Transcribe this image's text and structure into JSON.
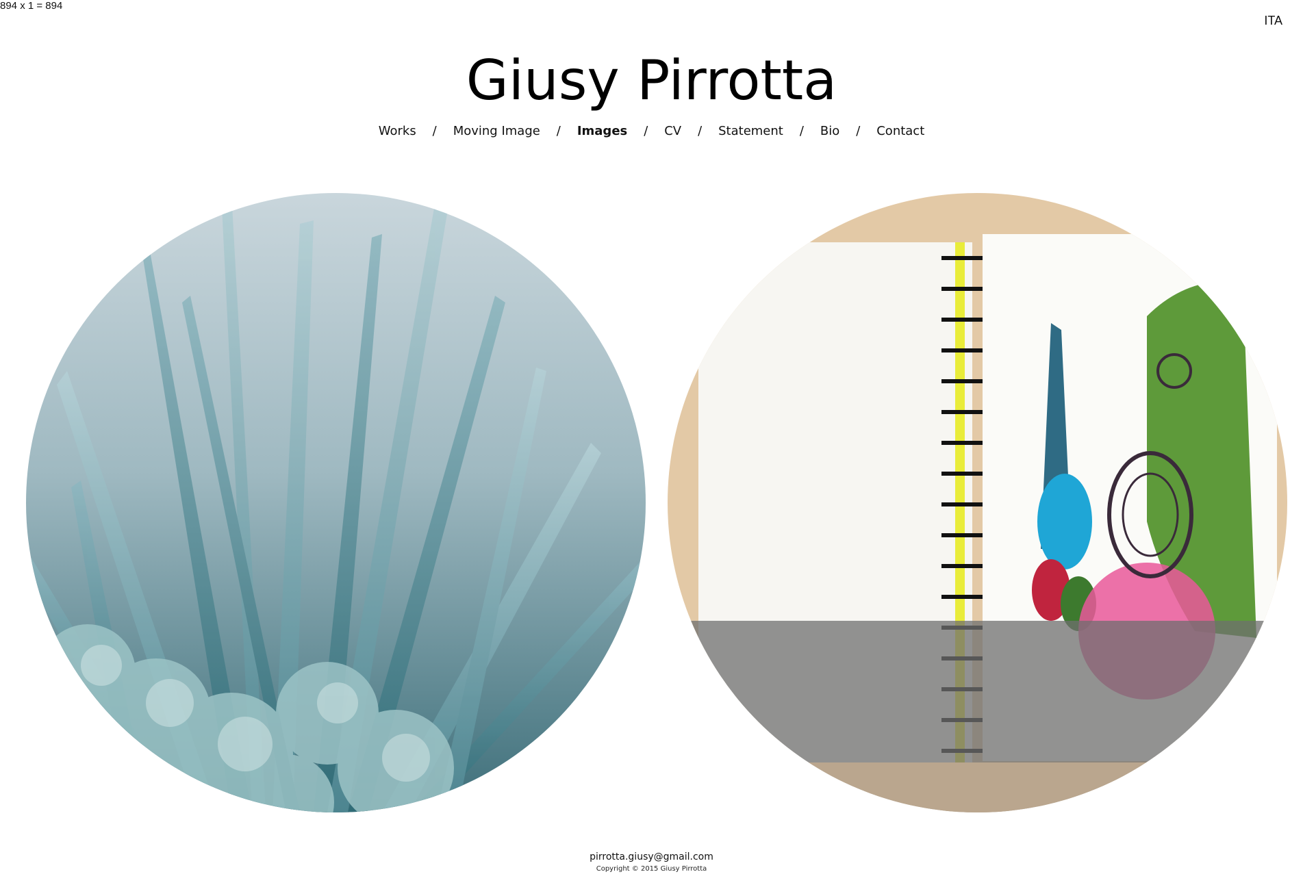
{
  "debug_text": "894 x 1 = 894",
  "language_switch": "ITA",
  "site_title": "Giusy Pirrotta",
  "nav": {
    "items": [
      {
        "label": "Works"
      },
      {
        "label": "Moving Image"
      },
      {
        "label": "Images",
        "active": true
      },
      {
        "label": "CV"
      },
      {
        "label": "Statement"
      },
      {
        "label": "Bio"
      },
      {
        "label": "Contact"
      }
    ],
    "separator": "/"
  },
  "gallery": {
    "items": [
      {
        "subject": "blue-green foliage photograph"
      },
      {
        "subject": "spiral sketchbook drawing"
      }
    ]
  },
  "footer": {
    "email": "pirrotta.giusy@gmail.com",
    "copyright": "Copyright © 2015 Giusy Pirrotta"
  }
}
